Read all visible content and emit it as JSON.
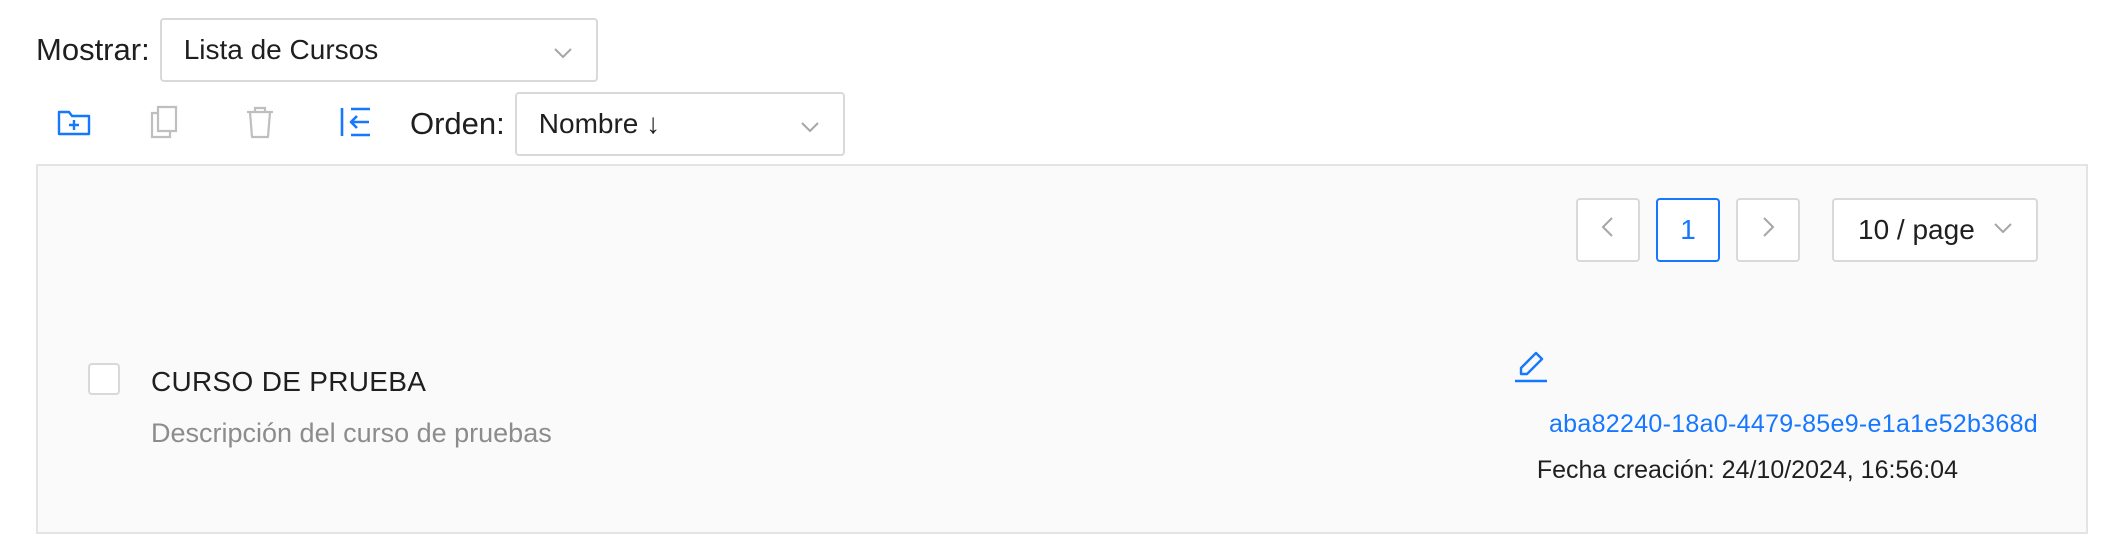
{
  "view": {
    "label": "Mostrar:",
    "selected": "Lista de Cursos"
  },
  "toolbar": {
    "icons": [
      "add-folder-icon",
      "copy-icon",
      "delete-icon",
      "collapse-icon"
    ],
    "sort_label": "Orden:",
    "sort_selected": "Nombre ↓"
  },
  "colors": {
    "accent": "#1677ff",
    "disabled": "#bfbfbf",
    "border": "#d9d9d9",
    "muted_text": "#8c8c8c"
  },
  "pagination": {
    "prev": "<",
    "current_page": "1",
    "next": ">",
    "page_size": "10 / page"
  },
  "courses": [
    {
      "title": "CURSO DE PRUEBA",
      "description": "Descripción del curso de pruebas",
      "id": "aba82240-18a0-4479-85e9-e1a1e52b368d",
      "created": "Fecha creación: 24/10/2024, 16:56:04"
    }
  ]
}
